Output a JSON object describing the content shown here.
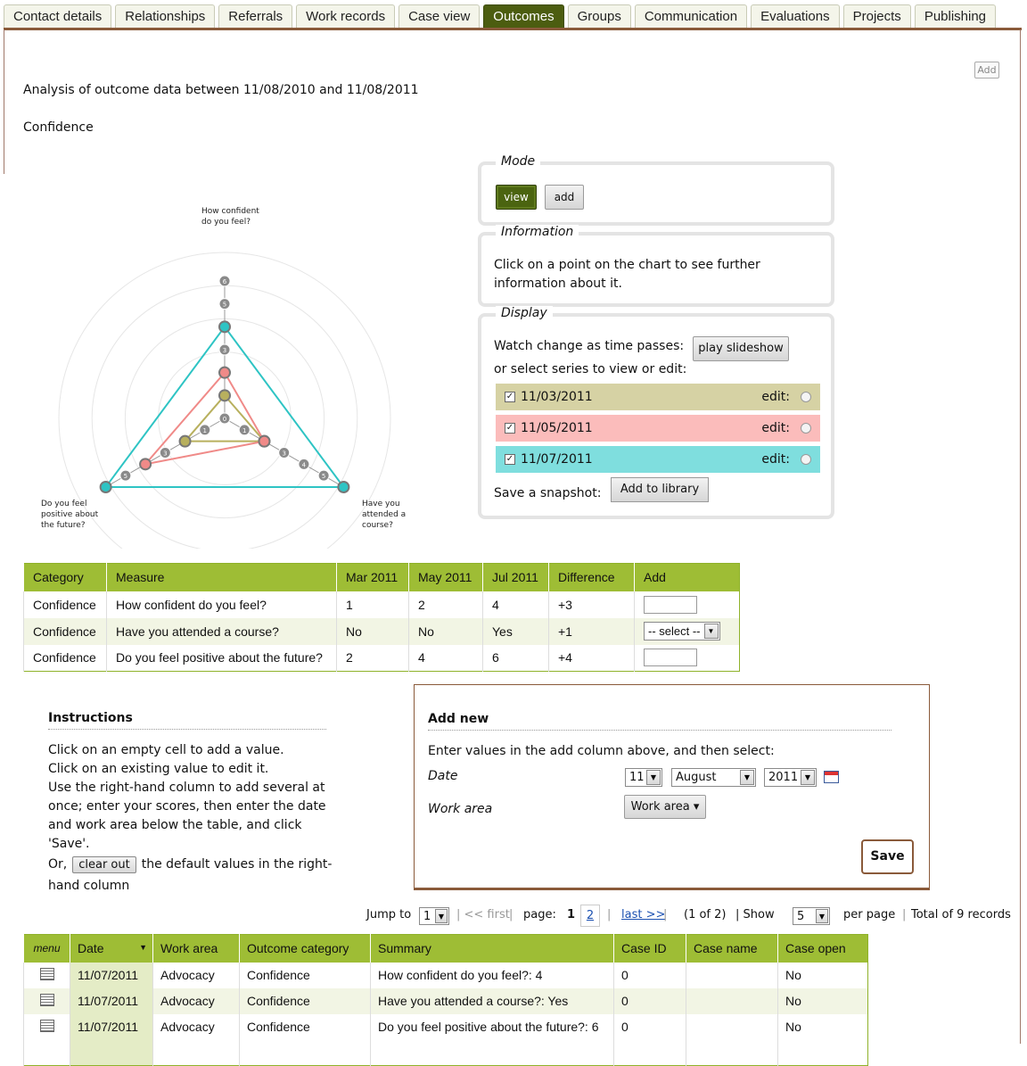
{
  "tabs": [
    "Contact details",
    "Relationships",
    "Referrals",
    "Work records",
    "Case view",
    "Outcomes",
    "Groups",
    "Communication",
    "Evaluations",
    "Projects",
    "Publishing"
  ],
  "active_tab": "Outcomes",
  "add_top_label": "Add",
  "analysis_text": "Analysis of outcome data between 11/08/2010 and 11/08/2011",
  "section_title": "Confidence",
  "chart_data": {
    "type": "radar",
    "axes": [
      "How confident do you feel?",
      "Have you attended a course?",
      "Do you feel positive about the future?"
    ],
    "axis_label_lines": [
      [
        "How confident",
        "do you feel?"
      ],
      [
        "Have you",
        "attended a",
        "course?"
      ],
      [
        "Do you feel",
        "positive about",
        "the future?"
      ]
    ],
    "ticks": [
      0,
      1,
      2,
      3,
      4,
      5,
      6
    ],
    "range": [
      0,
      6
    ],
    "series": [
      {
        "name": "11/03/2011",
        "color": "#b8b05e",
        "values": [
          1,
          2,
          2
        ]
      },
      {
        "name": "11/05/2011",
        "color": "#f08a88",
        "values": [
          2,
          2,
          4
        ]
      },
      {
        "name": "11/07/2011",
        "color": "#2ec4c4",
        "values": [
          4,
          6,
          6
        ]
      }
    ],
    "grid": true
  },
  "mode": {
    "legend": "Mode",
    "view_label": "view",
    "add_label": "add"
  },
  "information": {
    "legend": "Information",
    "text_line1": "Click on a point on the chart to see further",
    "text_line2": "information about it."
  },
  "display": {
    "legend": "Display",
    "watch_text": "Watch change as time passes:",
    "play_label": "play slideshow",
    "select_text": "or select series to view or edit:",
    "series": [
      {
        "date": "11/03/2011",
        "edit": "edit:",
        "bg": "#d6d2a4"
      },
      {
        "date": "11/05/2011",
        "edit": "edit:",
        "bg": "#fbbcbb"
      },
      {
        "date": "11/07/2011",
        "edit": "edit:",
        "bg": "#7fdede"
      }
    ],
    "snapshot_text": "Save a snapshot:",
    "library_label": "Add to library"
  },
  "data_table": {
    "headers": [
      "Category",
      "Measure",
      "Mar 2011",
      "May 2011",
      "Jul 2011",
      "Difference",
      "Add"
    ],
    "rows": [
      [
        "Confidence",
        "How confident do you feel?",
        "1",
        "2",
        "4",
        "+3"
      ],
      [
        "Confidence",
        "Have you attended a course?",
        "No",
        "No",
        "Yes",
        "+1"
      ],
      [
        "Confidence",
        "Do you feel positive about the future?",
        "2",
        "4",
        "6",
        "+4"
      ]
    ],
    "select_placeholder": "-- select --"
  },
  "instructions": {
    "title": "Instructions",
    "lines": [
      "Click on an empty cell to add a value.",
      "Click on an existing value to edit it.",
      "Use the right-hand column to add several at",
      "once; enter your scores, then enter the date",
      "and work area below the table, and click",
      "'Save'."
    ],
    "or_text": "Or,",
    "clear_label": "clear out",
    "tail1": "the default values in the right-",
    "tail2": "hand column"
  },
  "add_new": {
    "title": "Add new",
    "intro": "Enter values in the add column above, and then select:",
    "date_label": "Date",
    "day": "11",
    "month": "August",
    "year": "2011",
    "work_area_label": "Work area",
    "work_area_button": "Work area",
    "save_label": "Save"
  },
  "pager": {
    "jump_to": "Jump to",
    "jump_value": "1",
    "first": "<< first",
    "page_label": "page:",
    "page1": "1",
    "page2": "2",
    "last": "last >>",
    "of": "(1 of 2)",
    "show": "Show",
    "show_value": "5",
    "per_page": "per page",
    "total": "Total of 9 records"
  },
  "records": {
    "headers": [
      "menu",
      "Date",
      "Work area",
      "Outcome category",
      "Summary",
      "Case ID",
      "Case name",
      "Case open"
    ],
    "rows": [
      [
        "11/07/2011",
        "Advocacy",
        "Confidence",
        "How confident do you feel?: 4",
        "0",
        "",
        "No"
      ],
      [
        "11/07/2011",
        "Advocacy",
        "Confidence",
        "Have you attended a course?: Yes",
        "0",
        "",
        "No"
      ],
      [
        "11/07/2011",
        "Advocacy",
        "Confidence",
        "Do you feel positive about the future?: 6",
        "0",
        "",
        "No"
      ]
    ]
  }
}
